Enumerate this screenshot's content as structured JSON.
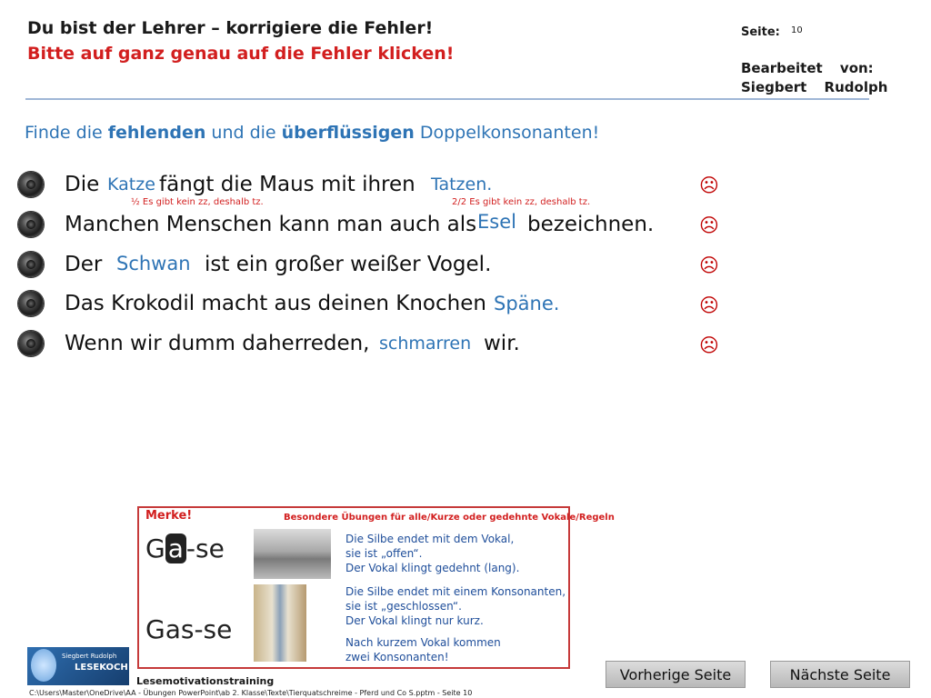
{
  "header": {
    "title": "Du bist der Lehrer – korrigiere die Fehler!",
    "subtitle": "Bitte auf ganz genau auf die Fehler klicken!",
    "page_label": "Seite:",
    "page_number": "10",
    "edited_by_line1": "Bearbeitet von:",
    "edited_by_line2": "Siegbert Rudolph"
  },
  "instruction": {
    "part1": "Finde die ",
    "bold1": "fehlenden",
    "part2": " und die ",
    "bold2": "überflüssigen",
    "part3": " Doppelkonsonanten!"
  },
  "sentences": [
    {
      "before": "Die",
      "word1": "Katze",
      "middle": "fängt die Maus mit ihren",
      "word2": "Tatzen.",
      "note1": "½ Es gibt kein zz, deshalb tz.",
      "note2": "2/2 Es gibt kein zz, deshalb tz.",
      "icon": "frown-icon"
    },
    {
      "before": "Manchen Menschen kann man auch als",
      "word": "Esel",
      "after": "bezeichnen.",
      "icon": "frown-icon"
    },
    {
      "before": "Der",
      "word": "Schwan",
      "after": "ist ein großer weißer Vogel.",
      "icon": "frown-icon"
    },
    {
      "before": "Das Krokodil macht aus deinen Knochen",
      "word": "Späne.",
      "icon": "frown-icon"
    },
    {
      "before": "Wenn wir dumm daherreden,",
      "word": "schmarren",
      "after": "wir.",
      "icon": "frown-icon"
    }
  ],
  "merke": {
    "title": "Merke!",
    "subtitle": "Besondere Übungen für alle/Kurze oder gedehnte Vokale/Regeln",
    "word1_a": "G",
    "word1_b": "a",
    "word1_c": "-se",
    "word2": "Gas-se",
    "text1_l1": "Die Silbe endet mit dem Vokal,",
    "text1_l2": "sie ist „offen“.",
    "text1_l3": "Der Vokal klingt gedehnt (lang).",
    "text2_l1": "Die Silbe endet mit einem Konsonanten,",
    "text2_l2": "sie ist „geschlossen“.",
    "text2_l3": "Der Vokal klingt nur kurz.",
    "text3_l1": "Nach kurzem Vokal kommen",
    "text3_l2": "zwei Konsonanten!"
  },
  "navigation": {
    "prev": "Vorherige Seite",
    "next": "Nächste Seite"
  },
  "footer": {
    "label": "Lesemotivationstraining",
    "path": "C:\\Users\\Master\\OneDrive\\AA - Übungen PowerPoint\\ab 2. Klasse\\Texte\\Tierquatschreime - Pferd und Co S.pptm - Seite 10",
    "logo_line1": "Siegbert Rudolph",
    "logo_line2": "LESEKOCH"
  },
  "colors": {
    "accent_blue": "#2e74b5",
    "error_red": "#d21f1f"
  }
}
